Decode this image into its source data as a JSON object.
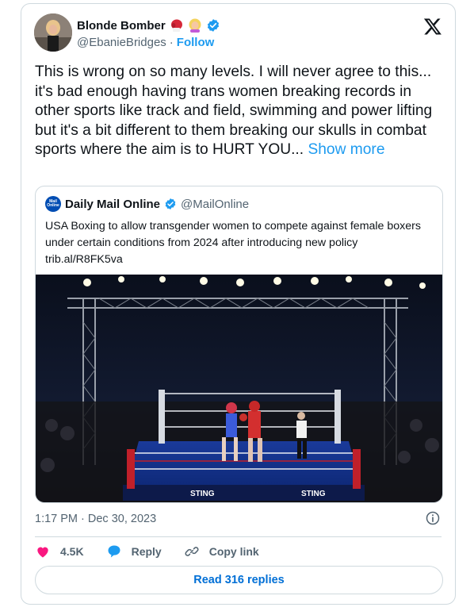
{
  "author": {
    "display_name": "Blonde Bomber",
    "handle": "@EbanieBridges",
    "separator": "·",
    "follow_label": "Follow"
  },
  "tweet": {
    "text": "This is wrong on so many levels. I will never agree to this... it's bad enough having trans women breaking records in other sports like track and field, swimming and power lifting but it's a bit different to them breaking our skulls in combat sports where the aim is to HURT YOU...",
    "show_more_label": "Show more",
    "timestamp": "1:17 PM · Dec 30, 2023"
  },
  "quoted": {
    "avatar_text": "Mail Online",
    "display_name": "Daily Mail Online",
    "handle": "@MailOnline",
    "text": "USA Boxing to allow transgender women to compete against female boxers under certain conditions from 2024 after introducing new policy trib.al/R8FK5va",
    "ring_banner": "STING"
  },
  "actions": {
    "like_count": "4.5K",
    "reply_label": "Reply",
    "copy_label": "Copy link",
    "read_replies_label": "Read 316 replies"
  },
  "colors": {
    "accent": "#1d9bf0",
    "like": "#f91880",
    "verified": "#1d9bf0"
  }
}
